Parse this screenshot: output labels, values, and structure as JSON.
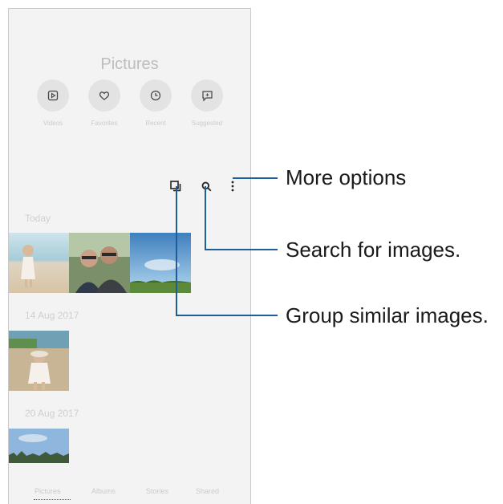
{
  "header": {
    "title": "Pictures"
  },
  "quick_actions": [
    {
      "label": "Videos",
      "icon": "play-square-icon"
    },
    {
      "label": "Favorites",
      "icon": "heart-icon"
    },
    {
      "label": "Recent",
      "icon": "clock-icon"
    },
    {
      "label": "Suggested",
      "icon": "sparkle-chat-icon"
    }
  ],
  "toolbar": {
    "group_icon": "group-similar-icon",
    "search_icon": "search-icon",
    "more_icon": "more-options-icon"
  },
  "sections": [
    {
      "date": "Today"
    },
    {
      "date": "14 Aug 2017"
    },
    {
      "date": "20 Aug 2017"
    }
  ],
  "bottom_nav": [
    "Pictures",
    "Albums",
    "Stories",
    "Shared"
  ],
  "callouts": {
    "more_options": "More options",
    "search": "Search for images.",
    "group": "Group similar images."
  },
  "colors": {
    "accent": "#1f5d9a"
  }
}
